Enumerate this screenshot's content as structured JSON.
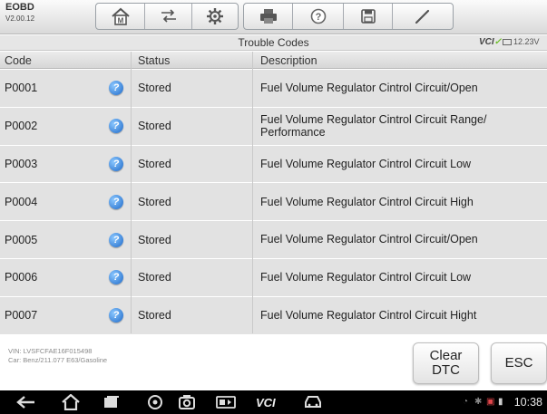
{
  "app": {
    "name": "EOBD",
    "version": "V2.00.12"
  },
  "toolbar": {
    "buttons": [
      {
        "name": "home",
        "icon": "home-icon"
      },
      {
        "name": "vehicle-swap",
        "icon": "vehicle-swap-icon"
      },
      {
        "name": "settings",
        "icon": "gear-icon"
      },
      {
        "name": "print",
        "icon": "printer-icon"
      },
      {
        "name": "help",
        "icon": "help-icon"
      },
      {
        "name": "save",
        "icon": "save-icon"
      },
      {
        "name": "edit",
        "icon": "pen-icon"
      }
    ]
  },
  "titlebar": {
    "title": "Trouble Codes",
    "vci": "VCI",
    "battery": "12.23V"
  },
  "table": {
    "headers": {
      "code": "Code",
      "status": "Status",
      "description": "Description"
    },
    "rows": [
      {
        "code": "P0001",
        "status": "Stored",
        "description": "Fuel Volume Regulator Cintrol Circuit/Open"
      },
      {
        "code": "P0002",
        "status": "Stored",
        "description": "Fuel Volume Regulator Cintrol Circuit Range/ Performance"
      },
      {
        "code": "P0003",
        "status": "Stored",
        "description": "Fuel Volume Regulator Cintrol Circuit Low"
      },
      {
        "code": "P0004",
        "status": "Stored",
        "description": "Fuel Volume Regulator Cintrol Circuit High"
      },
      {
        "code": "P0005",
        "status": "Stored",
        "description": "Fuel Volume Regulator Cintrol Circuit/Open"
      },
      {
        "code": "P0006",
        "status": "Stored",
        "description": "Fuel Volume Regulator Cintrol Circuit Low"
      },
      {
        "code": "P0007",
        "status": "Stored",
        "description": "Fuel Volume Regulator Cintrol Circuit Hight"
      }
    ]
  },
  "footer": {
    "vin": "VIN: LVSFCFAE16F015498",
    "car": "Car: Benz/211.077 E63/Gasoline",
    "clear_line1": "Clear",
    "clear_line2": "DTC",
    "esc": "ESC"
  },
  "statusbar": {
    "time": "10:38",
    "vcl": "VCI"
  },
  "colors": {
    "accent_blue": "#1c68c8",
    "vci_green": "#6fbf2d",
    "row_bg": "#e2e2e2"
  }
}
